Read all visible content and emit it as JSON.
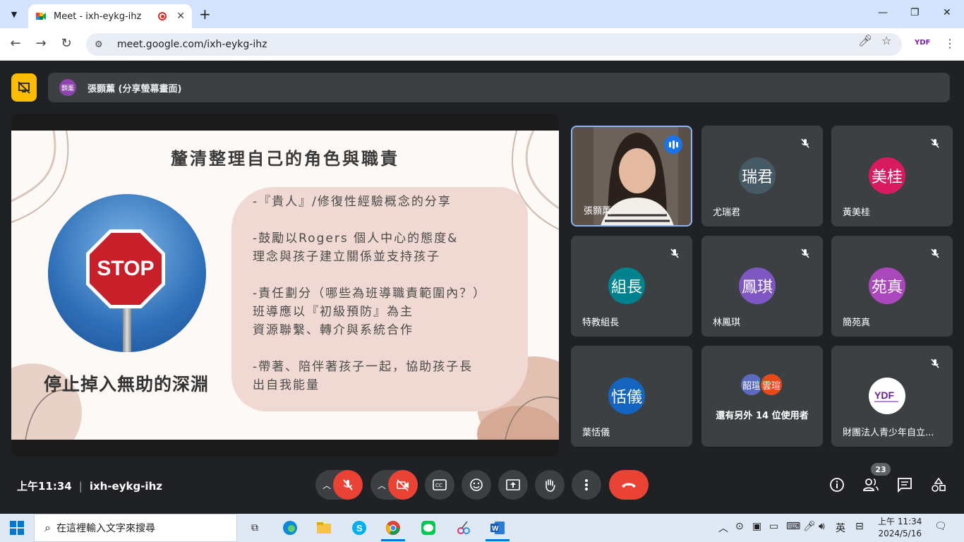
{
  "browser": {
    "tab_title": "Meet - ixh-eykg-ihz",
    "url": "meet.google.com/ixh-eykg-ihz"
  },
  "presentation": {
    "presenter_avatar_text": "顥薰",
    "presenter_label": "張顥薰 (分享螢幕畫面)"
  },
  "slide": {
    "title": "釐清整理自己的角色與職責",
    "stop_text": "STOP",
    "caption": "停止掉入無助的深淵",
    "bullets": [
      "-『貴人』/修復性經驗概念的分享",
      "-鼓勵以Rogers 個人中心的態度&\n理念與孩子建立關係並支持孩子",
      "-責任劃分（哪些為班導職責範圍內？）\n 班導應以『初級預防』為主\n資源聯繫、轉介與系統合作",
      "-帶著、陪伴著孩子一起，協助孩子長\n出自我能量"
    ]
  },
  "participants": [
    {
      "name": "張顥薰",
      "avatar": "",
      "color": "#5a5047",
      "speaking": true
    },
    {
      "name": "尤瑞君",
      "avatar": "瑞君",
      "color": "#455a64",
      "speaking": false
    },
    {
      "name": "黃美桂",
      "avatar": "美桂",
      "color": "#d81b60",
      "speaking": false
    },
    {
      "name": "特教組長",
      "avatar": "組長",
      "color": "#00838f",
      "speaking": false
    },
    {
      "name": "林鳳琪",
      "avatar": "鳳琪",
      "color": "#7e57c2",
      "speaking": false
    },
    {
      "name": "簡苑真",
      "avatar": "苑真",
      "color": "#ab47bc",
      "speaking": false
    },
    {
      "name": "葉恬儀",
      "avatar": "恬儀",
      "color": "#1565c0",
      "speaking": false
    },
    {
      "name": "財團法人青少年自立...",
      "avatar": "YDF",
      "color": "#ffffff",
      "speaking": false
    }
  ],
  "others": {
    "avatars": [
      {
        "text": "韶瑄",
        "color": "#5c6bc0"
      },
      {
        "text": "雲瑄",
        "color": "#e64a19"
      }
    ],
    "label": "還有另外 14 位使用者"
  },
  "footer": {
    "time": "上午11:34",
    "meeting_code": "ixh-eykg-ihz",
    "participant_count": "23"
  },
  "taskbar": {
    "search_placeholder": "在這裡輸入文字來搜尋",
    "ime": "英",
    "time": "上午 11:34",
    "date": "2024/5/16"
  },
  "colors": {
    "meet_bg": "#202124",
    "tile_bg": "#3c4043",
    "danger": "#ea4335",
    "accent": "#8ab4f8"
  }
}
